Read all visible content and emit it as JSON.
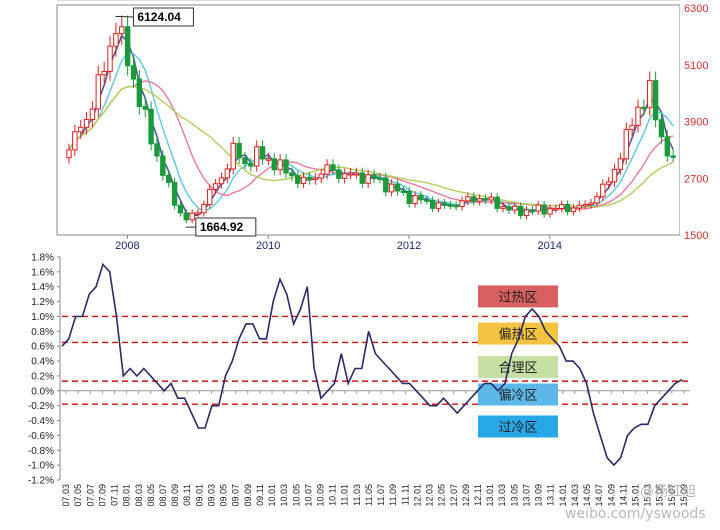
{
  "chart_data": [
    {
      "type": "candlestick",
      "title": "",
      "x_tick_labels": [
        "2008",
        "2010",
        "2012",
        "2014"
      ],
      "y_tick_labels": [
        "6300",
        "5100",
        "3900",
        "2700",
        "1500"
      ],
      "ylim": [
        1500,
        6300
      ],
      "annotations": [
        {
          "text": "6124.04",
          "x": 2007.83,
          "y": 6124
        },
        {
          "text": "1664.92",
          "x": 2008.83,
          "y": 1665
        }
      ],
      "close_approx": [
        {
          "x": 2007.17,
          "y": 3300
        },
        {
          "x": 2007.33,
          "y": 3800
        },
        {
          "x": 2007.5,
          "y": 4200
        },
        {
          "x": 2007.67,
          "y": 5100
        },
        {
          "x": 2007.83,
          "y": 5900
        },
        {
          "x": 2008.0,
          "y": 5300
        },
        {
          "x": 2008.17,
          "y": 4300
        },
        {
          "x": 2008.33,
          "y": 3600
        },
        {
          "x": 2008.5,
          "y": 2800
        },
        {
          "x": 2008.67,
          "y": 2200
        },
        {
          "x": 2008.83,
          "y": 1800
        },
        {
          "x": 2009.0,
          "y": 2000
        },
        {
          "x": 2009.17,
          "y": 2400
        },
        {
          "x": 2009.33,
          "y": 2700
        },
        {
          "x": 2009.5,
          "y": 3300
        },
        {
          "x": 2009.67,
          "y": 3000
        },
        {
          "x": 2009.83,
          "y": 3200
        },
        {
          "x": 2010.0,
          "y": 3100
        },
        {
          "x": 2010.5,
          "y": 2600
        },
        {
          "x": 2010.83,
          "y": 2900
        },
        {
          "x": 2011.0,
          "y": 2800
        },
        {
          "x": 2011.5,
          "y": 2700
        },
        {
          "x": 2012.0,
          "y": 2300
        },
        {
          "x": 2012.5,
          "y": 2100
        },
        {
          "x": 2013.0,
          "y": 2300
        },
        {
          "x": 2013.5,
          "y": 2000
        },
        {
          "x": 2014.0,
          "y": 2050
        },
        {
          "x": 2014.5,
          "y": 2100
        },
        {
          "x": 2014.83,
          "y": 2600
        },
        {
          "x": 2015.0,
          "y": 3200
        },
        {
          "x": 2015.25,
          "y": 4200
        },
        {
          "x": 2015.42,
          "y": 4500
        },
        {
          "x": 2015.58,
          "y": 3600
        },
        {
          "x": 2015.75,
          "y": 3000
        }
      ]
    },
    {
      "type": "line",
      "title": "",
      "y_tick_labels": [
        "1.8%",
        "1.6%",
        "1.4%",
        "1.2%",
        "1.0%",
        "0.8%",
        "0.6%",
        "0.4%",
        "0.2%",
        "0.0%",
        "-0.2%",
        "-0.4%",
        "-0.6%",
        "-0.8%",
        "-1.0%",
        "-1.2%"
      ],
      "ylim": [
        -1.2,
        1.8
      ],
      "x_tick_labels": [
        "07.03",
        "07.05",
        "07.07",
        "07.09",
        "07.11",
        "08.01",
        "08.03",
        "08.05",
        "08.07",
        "08.09",
        "08.11",
        "09.01",
        "09.03",
        "09.05",
        "09.07",
        "09.09",
        "09.11",
        "10.01",
        "10.03",
        "10.05",
        "10.07",
        "10.09",
        "10.11",
        "11.01",
        "11.03",
        "11.05",
        "11.07",
        "11.09",
        "11.11",
        "12.01",
        "12.03",
        "12.05",
        "12.07",
        "12.09",
        "12.11",
        "13.01",
        "13.03",
        "13.05",
        "13.07",
        "13.09",
        "13.11",
        "14.01",
        "14.03",
        "14.05",
        "14.07",
        "14.09",
        "14.11",
        "15.01",
        "15.03",
        "15.05",
        "15.07",
        "15.09"
      ],
      "values": [
        0.6,
        0.7,
        1.0,
        1.0,
        1.3,
        1.4,
        1.7,
        1.6,
        1.0,
        0.2,
        0.3,
        0.2,
        0.3,
        0.2,
        0.1,
        0.0,
        0.1,
        -0.1,
        -0.1,
        -0.3,
        -0.5,
        -0.5,
        -0.2,
        -0.2,
        0.2,
        0.4,
        0.7,
        0.9,
        0.9,
        0.7,
        0.7,
        1.2,
        1.5,
        1.3,
        0.9,
        1.1,
        1.4,
        0.3,
        -0.1,
        0.0,
        0.1,
        0.5,
        0.1,
        0.3,
        0.3,
        0.8,
        0.5,
        0.4,
        0.3,
        0.2,
        0.1,
        0.1,
        0.0,
        -0.1,
        -0.2,
        -0.2,
        -0.1,
        -0.2,
        -0.3,
        -0.2,
        -0.1,
        0.0,
        0.1,
        0.1,
        0.0,
        0.1,
        0.5,
        0.7,
        1.0,
        1.1,
        1.0,
        0.8,
        0.7,
        0.6,
        0.4,
        0.4,
        0.3,
        0.1,
        -0.3,
        -0.6,
        -0.9,
        -1.0,
        -0.9,
        -0.6,
        -0.5,
        -0.45,
        -0.45,
        -0.2,
        -0.1,
        0.0,
        0.1,
        0.15
      ],
      "reference_lines": [
        1.0,
        0.65,
        0.13,
        -0.18
      ],
      "zones": [
        {
          "label": "过热区",
          "y": 1.27,
          "color": "#d96060"
        },
        {
          "label": "偏热区",
          "y": 0.77,
          "color": "#f5c342"
        },
        {
          "label": "合理区",
          "y": 0.32,
          "color": "#c6e0a4"
        },
        {
          "label": "偏冷区",
          "y": -0.05,
          "color": "#5bb8e8"
        },
        {
          "label": "过冷区",
          "y": -0.48,
          "color": "#29a8e8"
        }
      ]
    }
  ],
  "watermark": "weibo.com/yswoods",
  "watermark_user": "@杨红旭"
}
